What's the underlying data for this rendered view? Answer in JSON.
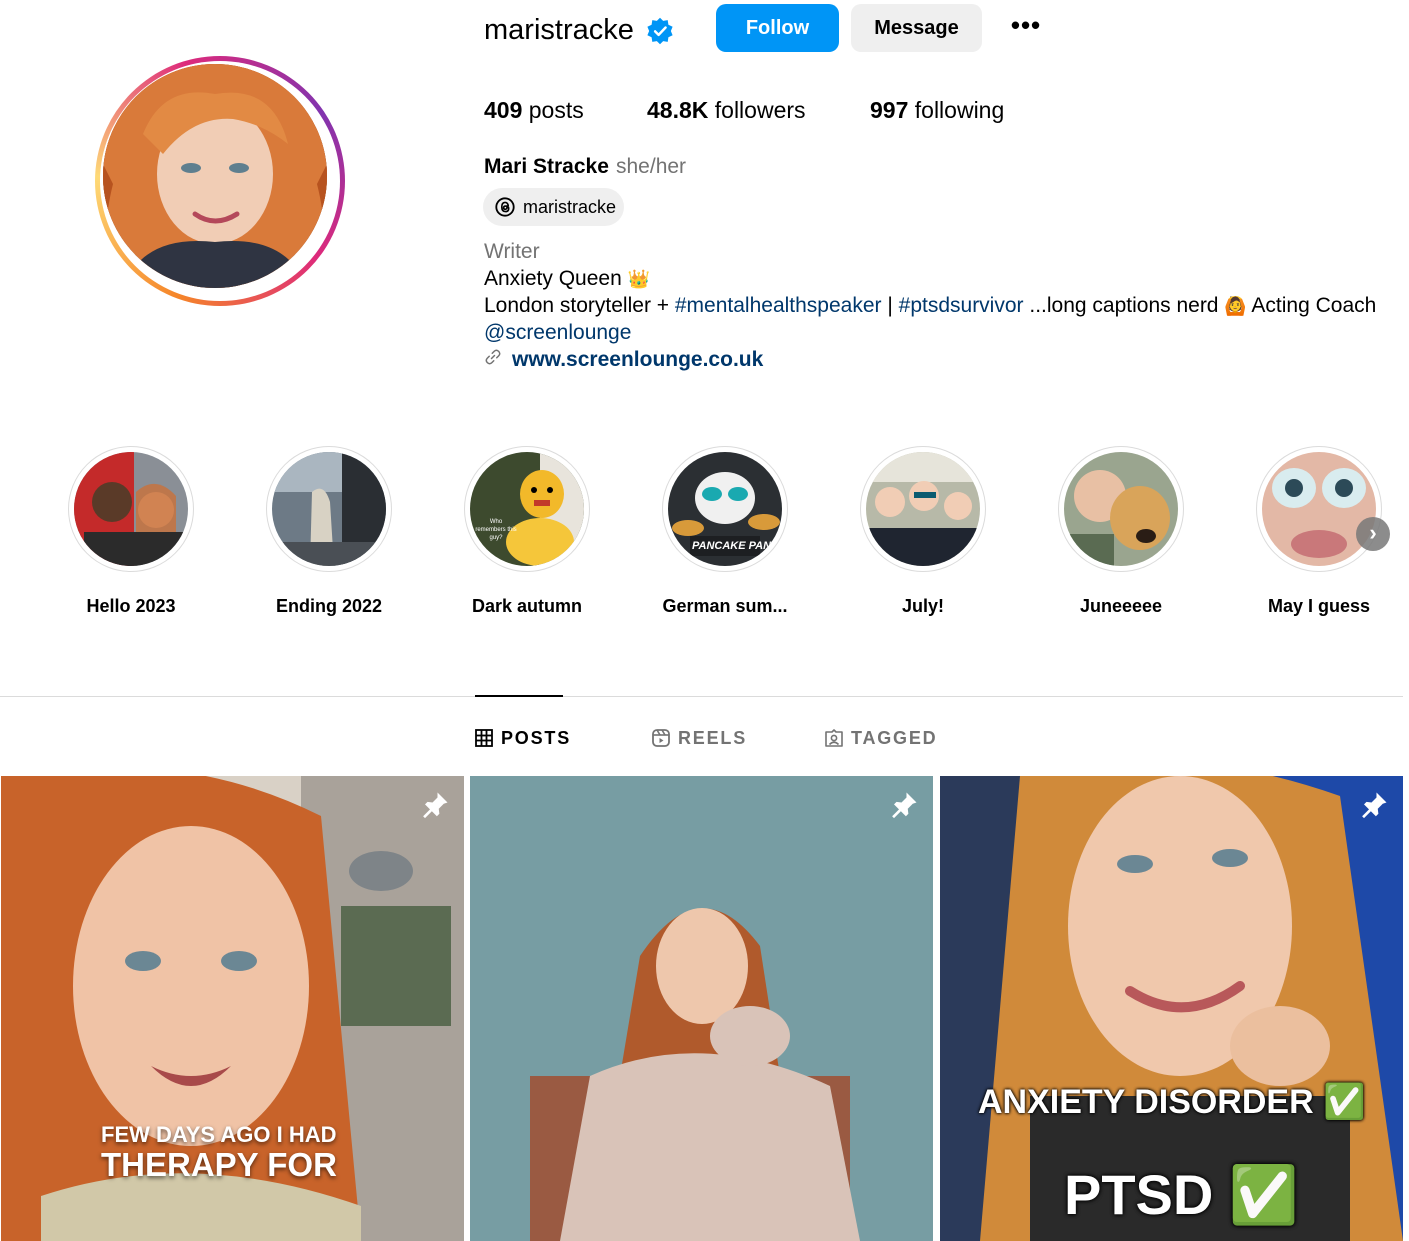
{
  "profile": {
    "username": "maristracke",
    "follow_label": "Follow",
    "message_label": "Message",
    "more_label": "•••",
    "stats": {
      "posts_count": "409",
      "posts_label": "posts",
      "followers_count": "48.8K",
      "followers_label": "followers",
      "following_count": "997",
      "following_label": "following"
    },
    "full_name": "Mari Stracke",
    "pronouns": "she/her",
    "threads_handle": "maristracke",
    "bio": {
      "category": "Writer",
      "line1": "Anxiety Queen",
      "line1_emoji": "👑",
      "line2_prefix": "London storyteller + ",
      "line2_tag1": "#mentalhealthspeaker",
      "line2_sep": " | ",
      "line2_tag2": "#ptsdsurvivor",
      "line2_suffix": " ...long captions nerd ",
      "line2_emoji": "🙆",
      "line2_end": " Acting Coach",
      "line3_mention": "@screenlounge"
    },
    "website": "www.screenlounge.co.uk"
  },
  "highlights": [
    {
      "label": "Hello 2023"
    },
    {
      "label": "Ending 2022"
    },
    {
      "label": "Dark autumn"
    },
    {
      "label": "German sum..."
    },
    {
      "label": "July!"
    },
    {
      "label": "Juneeeee"
    },
    {
      "label": "May I guess"
    }
  ],
  "tabs": [
    {
      "label": "POSTS",
      "icon": "grid-icon",
      "active": true
    },
    {
      "label": "REELS",
      "icon": "reels-icon",
      "active": false
    },
    {
      "label": "TAGGED",
      "icon": "tagged-icon",
      "active": false
    }
  ],
  "posts": [
    {
      "overlay_line1": "FEW DAYS AGO I HAD",
      "overlay_line2": "THERAPY FOR",
      "pinned": true
    },
    {
      "pinned": true
    },
    {
      "overlay_line1": "ANXIETY DISORDER ✅",
      "overlay_line2": "PTSD ✅",
      "pinned": true
    }
  ],
  "highlight_inner_text": {
    "dark_autumn_caption": "Who remembers this guy?",
    "german_summer_caption": "PANCAKE PANDA"
  },
  "colors": {
    "accent": "#0095f6",
    "link": "#00376b",
    "muted": "#737373"
  }
}
